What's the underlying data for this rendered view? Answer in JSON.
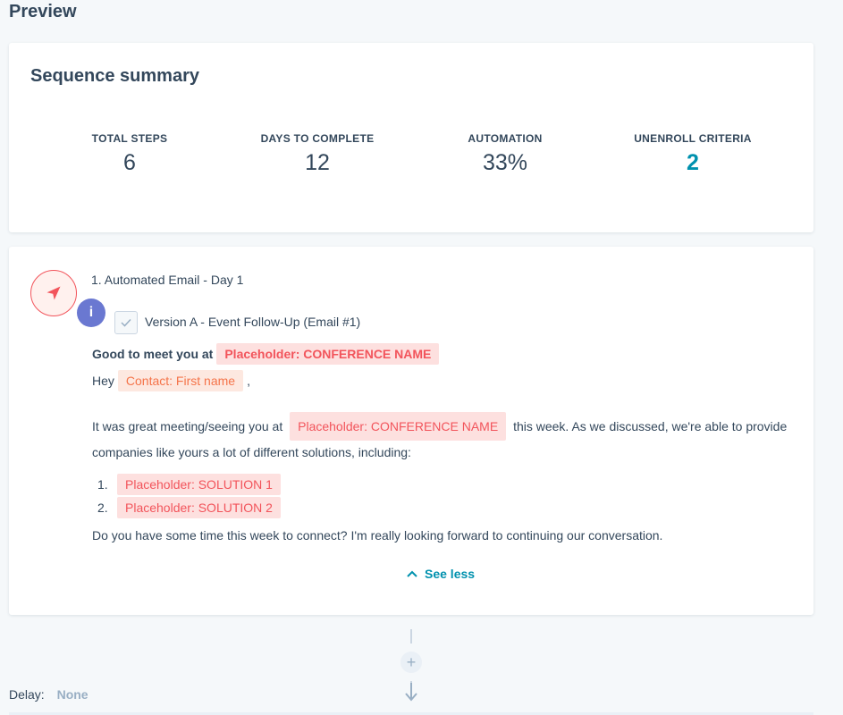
{
  "page": {
    "title": "Preview"
  },
  "summary": {
    "title": "Sequence summary",
    "stats": [
      {
        "label": "TOTAL STEPS",
        "value": "6"
      },
      {
        "label": "DAYS TO COMPLETE",
        "value": "12"
      },
      {
        "label": "AUTOMATION",
        "value": "33%"
      },
      {
        "label": "UNENROLL CRITERIA",
        "value": "2"
      }
    ]
  },
  "step": {
    "icon": "paper-plane-icon",
    "title": "1. Automated Email - Day 1",
    "badge": "i",
    "version_label": "Version A - Event Follow-Up (Email #1)",
    "subject_prefix": "Good to meet you at",
    "subject_token": "Placeholder: CONFERENCE NAME",
    "greeting_prefix": "Hey",
    "greeting_token": "Contact: First name",
    "greeting_suffix": ",",
    "para_prefix": "It was great meeting/seeing you at",
    "para_token": "Placeholder: CONFERENCE NAME",
    "para_suffix": "this week. As we discussed, we're able to provide",
    "para_line2": "companies like yours a lot of different solutions, including:",
    "solutions": [
      {
        "num": "1.",
        "token": "Placeholder: SOLUTION 1"
      },
      {
        "num": "2.",
        "token": "Placeholder: SOLUTION 2"
      }
    ],
    "closing": "Do you have some time this week to connect? I'm really looking forward to continuing our conversation.",
    "see_less": "See less"
  },
  "delay": {
    "label": "Delay:",
    "value": "None"
  },
  "colors": {
    "accent": "#0091ae",
    "token_bg": "#fde0df",
    "token_text": "#f2545b",
    "badge": "#6a78d1"
  }
}
